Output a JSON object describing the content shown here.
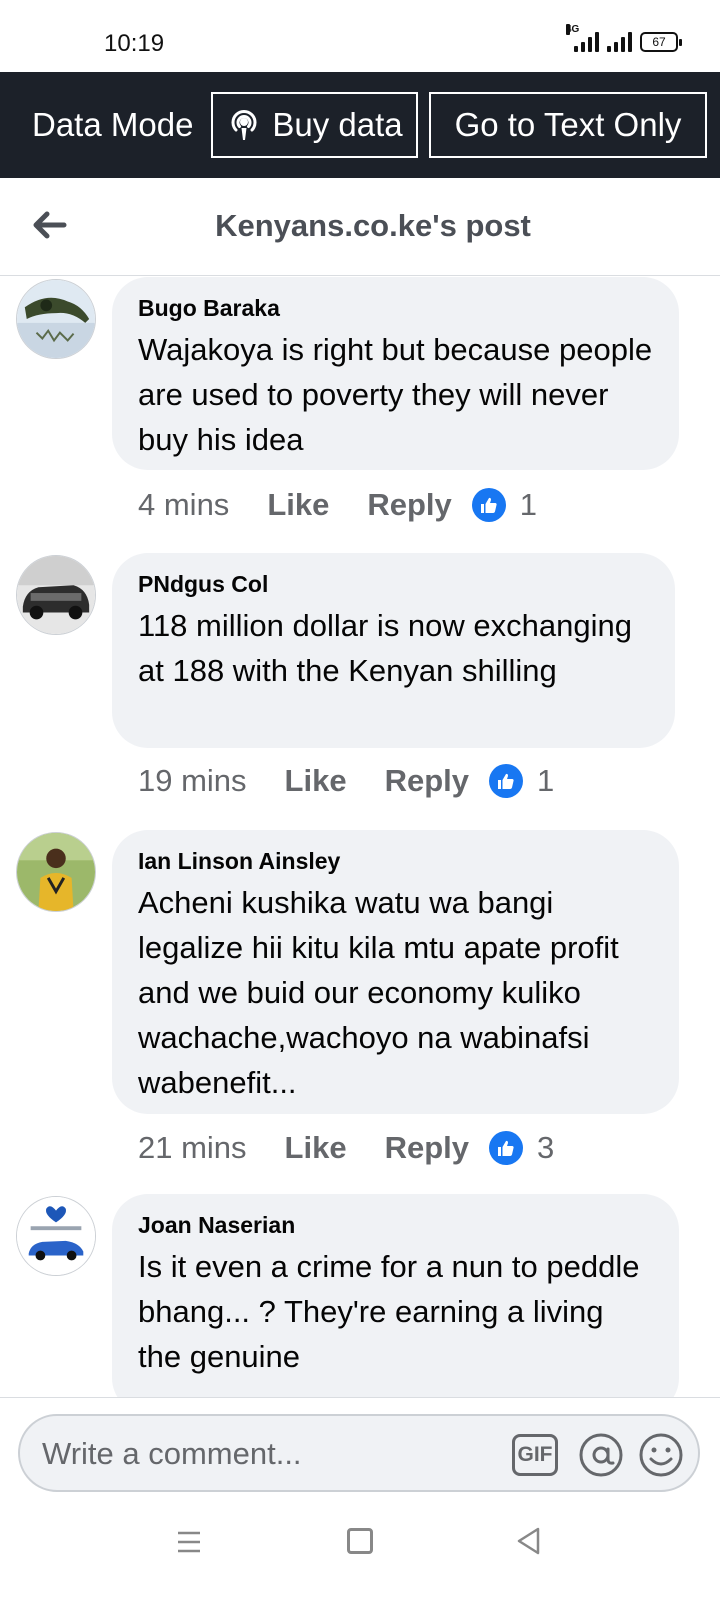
{
  "status_bar": {
    "time": "10:19",
    "network": "4G",
    "battery": "67"
  },
  "data_bar": {
    "mode_label": "Data Mode",
    "buy_data_label": "Buy data",
    "text_only_label": "Go to Text Only"
  },
  "header": {
    "title": "Kenyans.co.ke's post"
  },
  "comments": [
    {
      "name": "Bugo Baraka",
      "text": "Wajakoya is right but because people are used to poverty they will never buy his idea",
      "time": "4 mins",
      "like_label": "Like",
      "reply_label": "Reply",
      "reactions": "1"
    },
    {
      "name": "PNdgus Col",
      "text": "118 million dollar is now exchanging at 188 with the Kenyan shilling",
      "time": "19 mins",
      "like_label": "Like",
      "reply_label": "Reply",
      "reactions": "1"
    },
    {
      "name": "Ian Linson Ainsley",
      "text": "Acheni kushika watu wa bangi legalize hii kitu kila mtu apate profit and we buid our economy kuliko wachache,wachoyo na wabinafsi wabenefit...",
      "time": "21 mins",
      "like_label": "Like",
      "reply_label": "Reply",
      "reactions": "3"
    },
    {
      "name": "Joan Naserian",
      "text": "Is it even a crime for a nun to peddle bhang... ? They're earning a living the genuine",
      "time": "",
      "like_label": "",
      "reply_label": "",
      "reactions": ""
    }
  ],
  "composer": {
    "placeholder": "Write a comment...",
    "gif_label": "GIF"
  },
  "colors": {
    "data_bar_bg": "#1c2129",
    "bubble_bg": "#f0f2f5",
    "like_blue": "#1877f2",
    "secondary_text": "#65676b"
  },
  "icons": [
    "back-arrow-icon",
    "podcast-icon",
    "thumbs-up-icon",
    "gif-icon",
    "at-icon",
    "emoji-icon",
    "menu-icon",
    "home-icon",
    "nav-back-icon"
  ]
}
